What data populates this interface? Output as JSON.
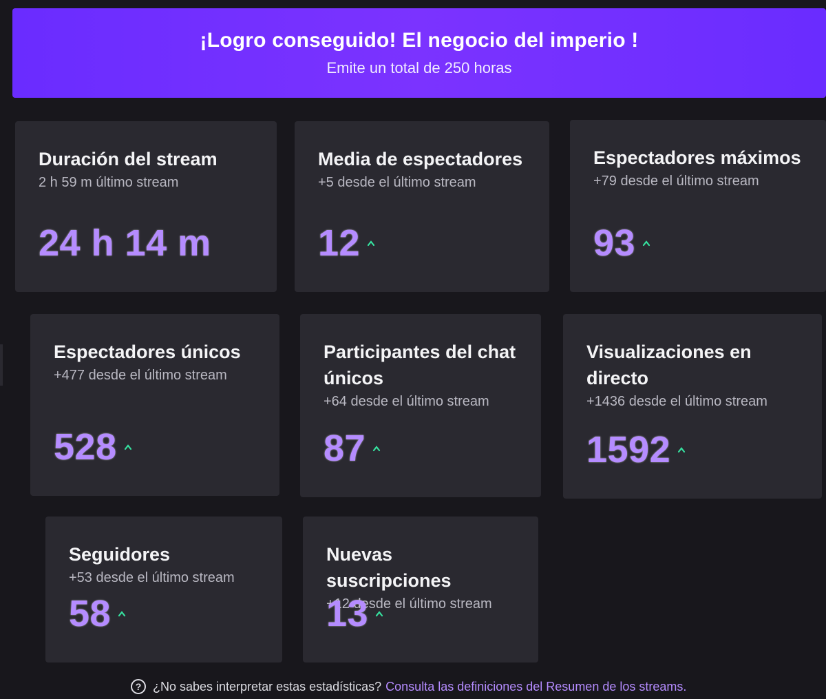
{
  "banner": {
    "title": "¡Logro conseguido! El negocio del imperio !",
    "subtitle": "Emite un total de 250 horas"
  },
  "accent_color": "#b58cff",
  "up_arrow_color": "#36e3a0",
  "cards": [
    {
      "title": "Duración del stream",
      "subtitle": "2 h 59 m último stream",
      "value": "24 h 14 m",
      "arrow": false
    },
    {
      "title": "Media de espectadores",
      "subtitle": "+5 desde el último stream",
      "value": "12",
      "arrow": true
    },
    {
      "title": "Espectadores máximos",
      "subtitle": "+79 desde el último stream",
      "value": "93",
      "arrow": true
    },
    {
      "title": "Espectadores únicos",
      "subtitle": "+477 desde el último stream",
      "value": "528",
      "arrow": true
    },
    {
      "title": "Participantes del chat únicos",
      "subtitle": "+64 desde el último stream",
      "value": "87",
      "arrow": true
    },
    {
      "title": "Visualizaciones en directo",
      "subtitle": "+1436 desde el último stream",
      "value": "1592",
      "arrow": true
    },
    {
      "title": "Seguidores",
      "subtitle": "+53 desde el último stream",
      "value": "58",
      "arrow": true
    },
    {
      "title": "Nuevas suscripciones",
      "subtitle": "+12 desde el último stream",
      "value": "13",
      "arrow": true
    }
  ],
  "footer": {
    "question": "¿No sabes interpretar estas estadísticas?",
    "link": "Consulta las definiciones del Resumen de los streams."
  }
}
